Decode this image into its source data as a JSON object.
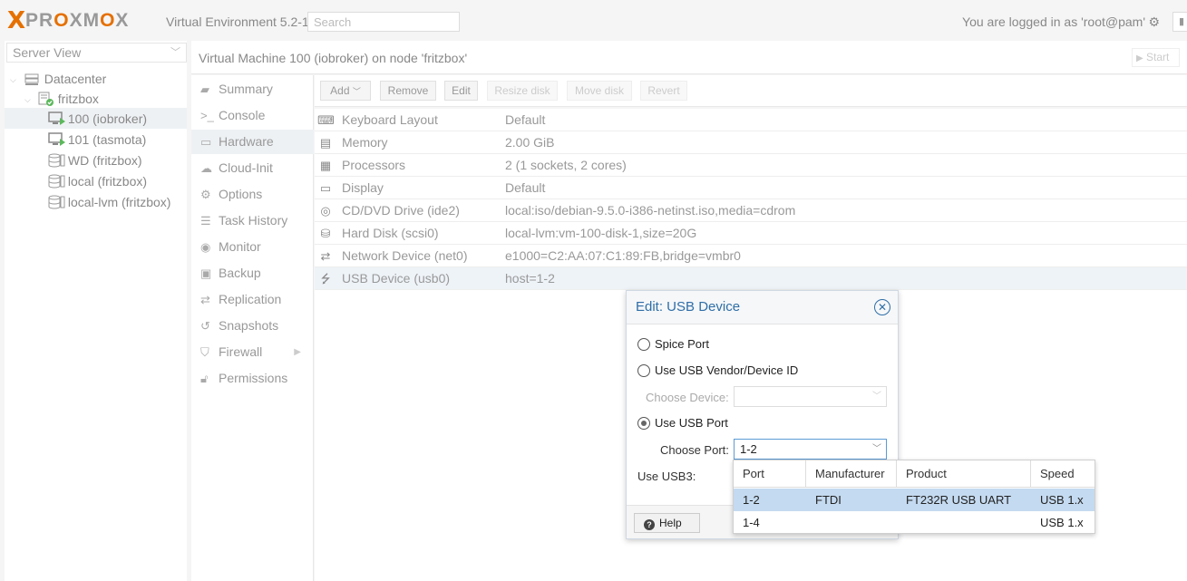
{
  "header": {
    "logo_x": "X",
    "logo_word_1": "PR",
    "logo_o1": "O",
    "logo_word_2": "XM",
    "logo_o2": "O",
    "logo_word_3": "X",
    "env_title": "Virtual Environment 5.2-1",
    "search_placeholder": "Search",
    "login_text": "You are logged in as 'root@pam'"
  },
  "tree": {
    "view_label": "Server View",
    "items": [
      {
        "label": "Datacenter"
      },
      {
        "label": "fritzbox"
      },
      {
        "label": "100 (iobroker)"
      },
      {
        "label": "101 (tasmota)"
      },
      {
        "label": "WD (fritzbox)"
      },
      {
        "label": "local (fritzbox)"
      },
      {
        "label": "local-lvm (fritzbox)"
      }
    ]
  },
  "content": {
    "title": "Virtual Machine 100 (iobroker) on node 'fritzbox'",
    "start_label": "Start"
  },
  "nav": {
    "items": [
      {
        "label": "Summary"
      },
      {
        "label": "Console"
      },
      {
        "label": "Hardware"
      },
      {
        "label": "Cloud-Init"
      },
      {
        "label": "Options"
      },
      {
        "label": "Task History"
      },
      {
        "label": "Monitor"
      },
      {
        "label": "Backup"
      },
      {
        "label": "Replication"
      },
      {
        "label": "Snapshots"
      },
      {
        "label": "Firewall"
      },
      {
        "label": "Permissions"
      }
    ]
  },
  "toolbar": {
    "add": "Add",
    "remove": "Remove",
    "edit": "Edit",
    "resize": "Resize disk",
    "move": "Move disk",
    "revert": "Revert"
  },
  "hardware": [
    {
      "key": "Keyboard Layout",
      "value": "Default"
    },
    {
      "key": "Memory",
      "value": "2.00 GiB"
    },
    {
      "key": "Processors",
      "value": "2 (1 sockets, 2 cores)"
    },
    {
      "key": "Display",
      "value": "Default"
    },
    {
      "key": "CD/DVD Drive (ide2)",
      "value": "local:iso/debian-9.5.0-i386-netinst.iso,media=cdrom"
    },
    {
      "key": "Hard Disk (scsi0)",
      "value": "local-lvm:vm-100-disk-1,size=20G"
    },
    {
      "key": "Network Device (net0)",
      "value": "e1000=C2:AA:07:C1:89:FB,bridge=vmbr0"
    },
    {
      "key": "USB Device (usb0)",
      "value": "host=1-2"
    }
  ],
  "modal": {
    "title": "Edit: USB Device",
    "opt_spice": "Spice Port",
    "opt_vendor": "Use USB Vendor/Device ID",
    "choose_device_label": "Choose Device:",
    "opt_port": "Use USB Port",
    "choose_port_label": "Choose Port:",
    "choose_port_value": "1-2",
    "usb3_label": "Use USB3:",
    "help": "Help",
    "selected_option": "Use USB Port"
  },
  "dropdown": {
    "columns": [
      "Port",
      "Manufacturer",
      "Product",
      "Speed"
    ],
    "rows": [
      {
        "port": "1-2",
        "manufacturer": "FTDI",
        "product": "FT232R USB UART",
        "speed": "USB 1.x"
      },
      {
        "port": "1-4",
        "manufacturer": "",
        "product": "",
        "speed": "USB 1.x"
      }
    ]
  }
}
